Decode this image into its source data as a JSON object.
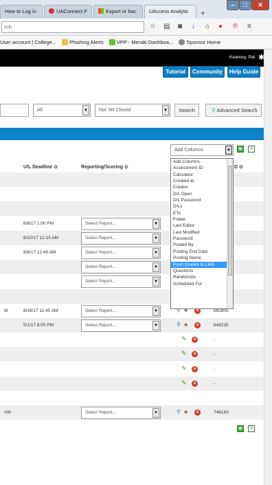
{
  "browser": {
    "tabs": [
      {
        "label": "How to Log in"
      },
      {
        "label": "UAConnect F"
      },
      {
        "label": "Export or bac"
      },
      {
        "label": "UAccess Analytic"
      }
    ],
    "new_tab": "+",
    "url_text": "rch",
    "bookmarks": [
      {
        "label": "User account | College..."
      },
      {
        "label": "Phishing Alerts"
      },
      {
        "label": "VPP - Meraki Dashboa..."
      },
      {
        "label": "Sponsor Home"
      }
    ]
  },
  "app": {
    "user_name": "Kearney, Pat",
    "header_buttons": {
      "tutorial": "Tutorial",
      "community": "Community",
      "help": "Help Guide"
    },
    "filters": {
      "all_value": "All",
      "status_value": "Not Yet Closed",
      "search_label": "Search",
      "advanced_search_label": "Advanced Search"
    },
    "add_columns": {
      "value": "Add Columns",
      "options": [
        "Add Columns",
        "Assessment ID",
        "Calculator",
        "Created at",
        "Creator",
        "D/L Open",
        "D/L Password",
        "D/Ls",
        "ETs",
        "Folder",
        "Last Editor",
        "Last Modified",
        "Password",
        "Posted By",
        "Posting End Date",
        "Posting Name",
        "Push Grades to LMS",
        "Questions",
        "Randomize",
        "Scheduled For"
      ],
      "highlighted": "Push Grades to LMS"
    },
    "columns": {
      "deadline": "U/L Deadline",
      "reporting": "Reporting/Scoring",
      "id": "D"
    },
    "select_report_placeholder": "Select Report...",
    "rows": [
      {
        "prefix": "",
        "deadline": "",
        "report": false,
        "actions": "",
        "id": "",
        "alt": true
      },
      {
        "prefix": "",
        "deadline": "",
        "report": false,
        "actions": "",
        "id": "",
        "alt": false
      },
      {
        "prefix": "",
        "deadline": "",
        "report": false,
        "actions": "",
        "id": "",
        "alt": true
      },
      {
        "prefix": "",
        "deadline": "8/8/17 1:00 PM",
        "report": true,
        "actions": "",
        "id": "",
        "alt": false
      },
      {
        "prefix": "",
        "deadline": "8/10/17 12:15 AM",
        "report": true,
        "actions": "",
        "id": "",
        "alt": true
      },
      {
        "prefix": "",
        "deadline": "8/8/17 12:45 AM",
        "report": true,
        "actions": "",
        "id": "",
        "alt": false
      },
      {
        "prefix": "",
        "deadline": "",
        "report": true,
        "actions": "",
        "id": "",
        "alt": true
      },
      {
        "prefix": "",
        "deadline": "",
        "report": true,
        "actions": "",
        "id": "",
        "alt": false
      },
      {
        "prefix": "",
        "deadline": "",
        "report": false,
        "actions": "",
        "id": "",
        "alt": true
      },
      {
        "prefix": "M",
        "deadline": "8/18/17 11:45 AM",
        "report": true,
        "actions": "full",
        "id": "882805",
        "alt": false
      },
      {
        "prefix": "",
        "deadline": "5/1/17 8:00 PM",
        "report": true,
        "actions": "full",
        "id": "848235",
        "alt": true
      },
      {
        "prefix": "",
        "deadline": "",
        "report": false,
        "actions": "edit",
        "id": "-",
        "alt": false
      },
      {
        "prefix": "",
        "deadline": "",
        "report": false,
        "actions": "edit",
        "id": "-",
        "alt": true
      },
      {
        "prefix": "",
        "deadline": "",
        "report": false,
        "actions": "edit",
        "id": "-",
        "alt": false
      },
      {
        "prefix": "",
        "deadline": "",
        "report": false,
        "actions": "edit",
        "id": "-",
        "alt": true
      },
      {
        "prefix": "",
        "deadline": "",
        "report": false,
        "actions": "",
        "id": "",
        "alt": false
      },
      {
        "prefix": "AM",
        "deadline": "",
        "report": true,
        "actions": "full",
        "id": "746183",
        "alt": true
      }
    ]
  },
  "colors": {
    "accent": "#0f82c8",
    "header": "#000000",
    "highlight": "#3399ff"
  }
}
